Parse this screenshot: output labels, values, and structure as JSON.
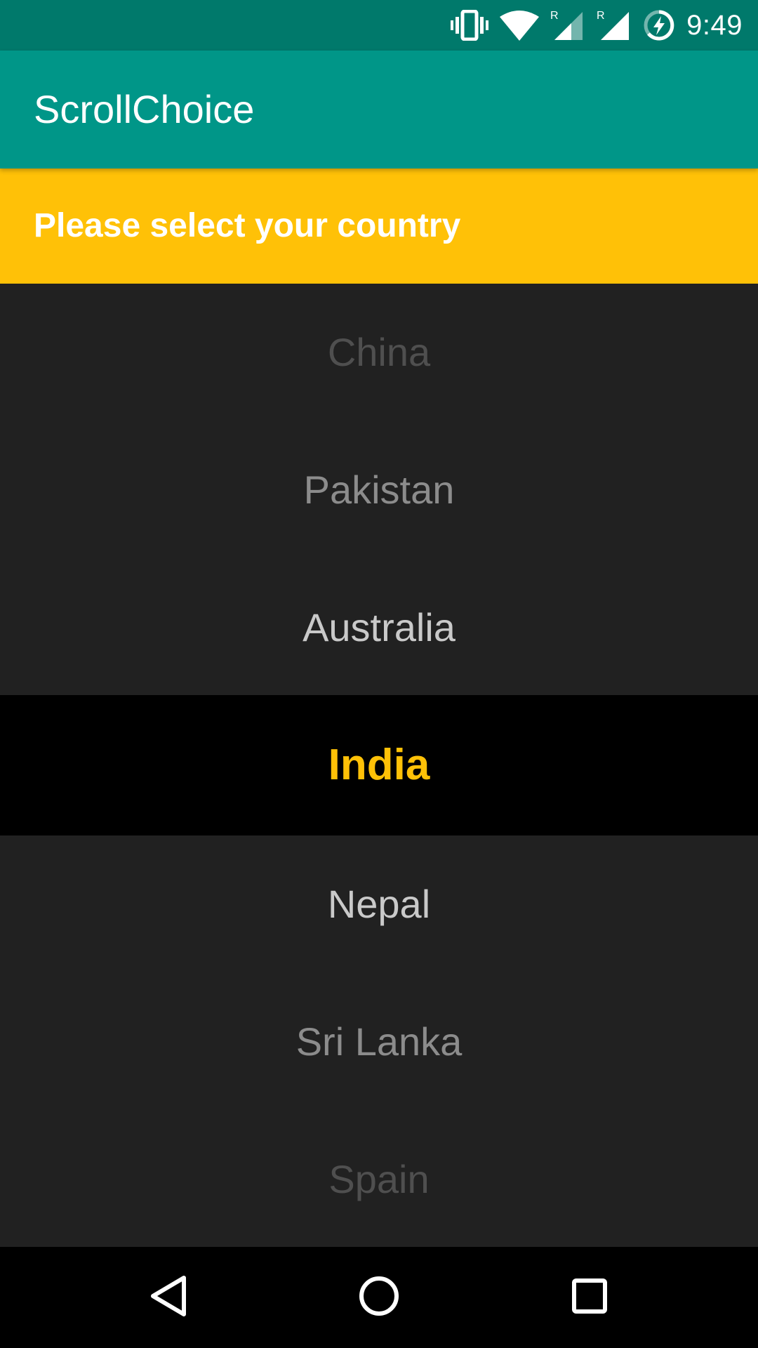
{
  "status_bar": {
    "time": "9:49",
    "icons": [
      "vibrate-icon",
      "wifi-icon",
      "signal-roaming-icon",
      "signal-roaming-icon",
      "battery-charging-icon"
    ],
    "roaming_label": "R",
    "color": "#00796b"
  },
  "app_bar": {
    "title": "ScrollChoice",
    "color": "#009688"
  },
  "prompt": {
    "text": "Please select your country",
    "color": "#ffc107"
  },
  "picker": {
    "items": [
      "China",
      "Pakistan",
      "Australia",
      "India",
      "Nepal",
      "Sri Lanka",
      "Spain"
    ],
    "selected": "India",
    "selected_color": "#ffc107",
    "background": "#212121"
  },
  "nav_bar": {
    "buttons": [
      "back-icon",
      "home-icon",
      "recents-icon"
    ]
  }
}
